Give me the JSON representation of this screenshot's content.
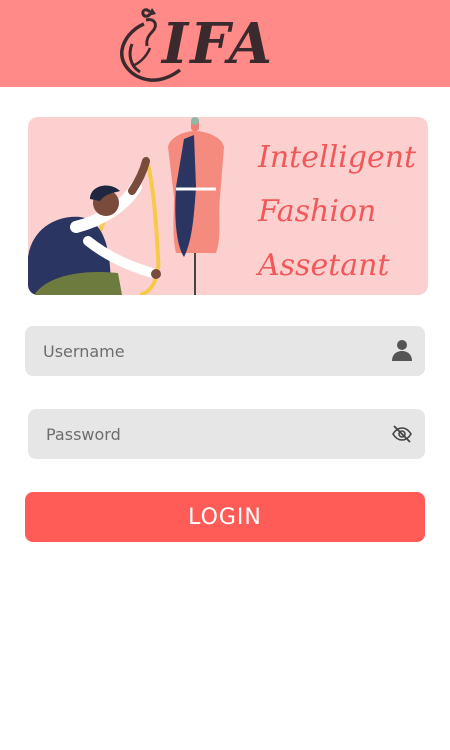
{
  "header": {
    "logo_text": "IFA",
    "background": "#ff8a87"
  },
  "banner": {
    "tagline": [
      "Intelligent",
      "Fashion",
      "Assetant"
    ],
    "background": "#fcd0cf",
    "text_color": "#f0585a"
  },
  "form": {
    "username": {
      "placeholder": "Username",
      "value": "",
      "icon": "user-icon"
    },
    "password": {
      "placeholder": "Password",
      "value": "",
      "icon": "eye-off-icon"
    },
    "login_label": "LOGIN",
    "login_color": "#ff5c57"
  }
}
